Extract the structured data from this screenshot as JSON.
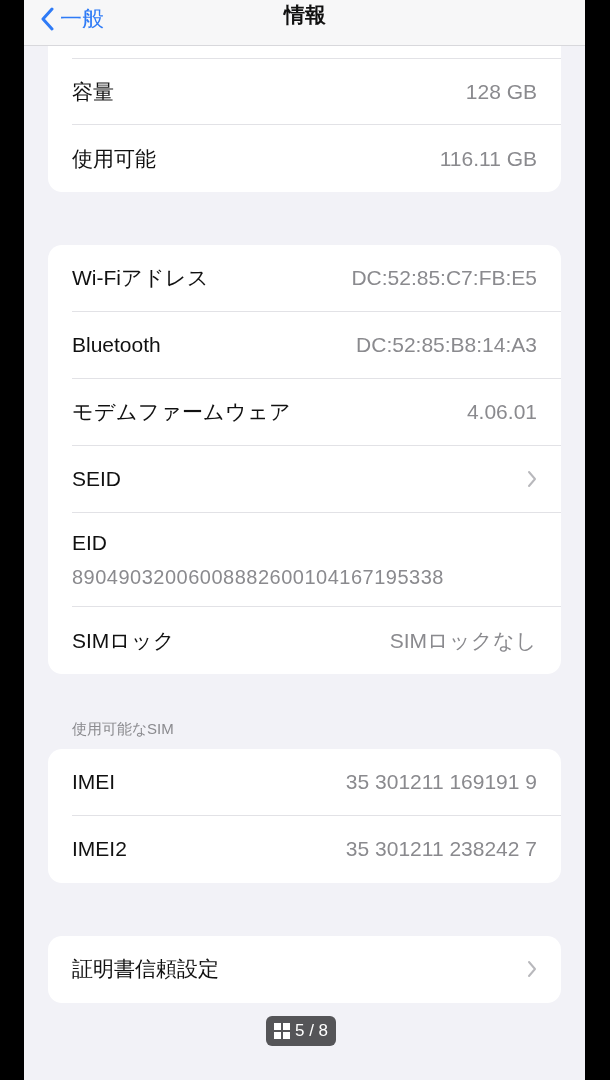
{
  "nav_bar": {
    "back_label": "一般",
    "title": "情報"
  },
  "groups": [
    {
      "rows": [
        {
          "kind": "value",
          "label": "容量",
          "value": "128 GB"
        },
        {
          "kind": "value",
          "label": "使用可能",
          "value": "116.11 GB"
        }
      ]
    },
    {
      "rows": [
        {
          "kind": "value",
          "label": "Wi-Fiアドレス",
          "value": "DC:52:85:C7:FB:E5"
        },
        {
          "kind": "value",
          "label": "Bluetooth",
          "value": "DC:52:85:B8:14:A3"
        },
        {
          "kind": "value",
          "label": "モデムファームウェア",
          "value": "4.06.01"
        },
        {
          "kind": "chevron",
          "label": "SEID"
        },
        {
          "kind": "stacked",
          "label": "EID",
          "value": "89049032006008882600104167195338"
        },
        {
          "kind": "value",
          "label": "SIMロック",
          "value": "SIMロックなし"
        }
      ]
    },
    {
      "header": "使用可能なSIM",
      "rows": [
        {
          "kind": "value",
          "label": "IMEI",
          "value": "35 301211 169191 9"
        },
        {
          "kind": "value",
          "label": "IMEI2",
          "value": "35 301211 238242 7"
        }
      ]
    },
    {
      "rows": [
        {
          "kind": "chevron",
          "label": "証明書信頼設定"
        }
      ]
    }
  ],
  "page_indicator": "5 / 8"
}
